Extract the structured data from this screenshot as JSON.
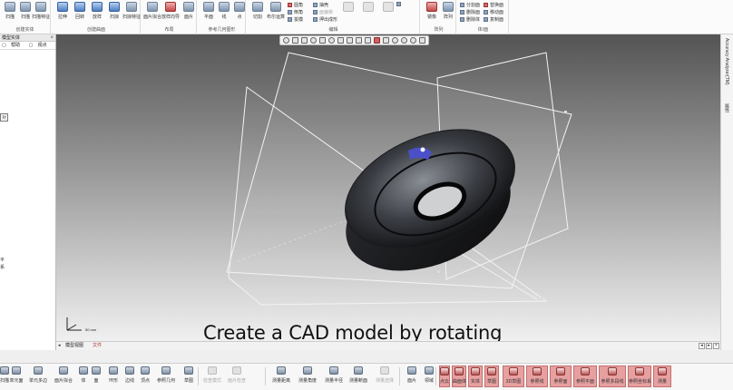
{
  "ribbon": {
    "groups": [
      {
        "label": "创建实体",
        "buttons": [
          "扫描",
          "扫描",
          "扫描特征"
        ]
      },
      {
        "label": "创建曲面",
        "buttons": [
          "拉伸",
          "回转",
          "放样",
          "扫掠",
          "扫掠特征"
        ]
      },
      {
        "label": "布局",
        "buttons": [
          "面片拟合",
          "放样向导",
          "面片"
        ]
      },
      {
        "label": "参考几何图形",
        "buttons": [
          "平面",
          "线",
          "点"
        ]
      },
      {
        "label": "编辑",
        "buttons": [
          "切割",
          "布尔运算"
        ],
        "small": [
          "圆角",
          "倒角",
          "拔模",
          "抽壳",
          "面偏移",
          "押出成形"
        ]
      },
      {
        "label": "阵列",
        "buttons": [
          "镜像",
          "阵列"
        ]
      },
      {
        "label": "体/面",
        "small": [
          "分割面",
          "删除面",
          "删除体",
          "替换面",
          "移动面",
          "复制面"
        ]
      }
    ]
  },
  "left_panel": {
    "title": "模型实体",
    "tabs": [
      "帮助",
      "视点"
    ],
    "tree": [
      "对",
      "平",
      "系"
    ]
  },
  "view_toolbar": {
    "icons": [
      "select-icon",
      "view-icon",
      "fit-icon",
      "zoom-icon",
      "pan-icon",
      "rotate-icon",
      "section-icon",
      "display-icon",
      "render-icon",
      "light-icon",
      "color-icon",
      "texture-icon",
      "measure-icon",
      "probe-icon",
      "ref-icon",
      "hide-icon"
    ]
  },
  "right_rail": {
    "items": [
      "Accuracy Analyzer(TM)",
      "属性"
    ]
  },
  "viewport": {
    "caption": "Create a CAD model by rotating",
    "triad_label": "50 mm"
  },
  "tabstrip": {
    "tabs": [
      "模型视图",
      "文件"
    ],
    "active": 1
  },
  "cmdbar": {
    "buttons": [
      {
        "label": "扫描",
        "state": "normal"
      },
      {
        "label": "单元面",
        "state": "normal"
      },
      {
        "label": "单元多边",
        "state": "normal"
      },
      {
        "label": "面片拟合",
        "state": "normal"
      },
      {
        "label": "体",
        "state": "normal"
      },
      {
        "label": "面",
        "state": "normal"
      },
      {
        "label": "环形",
        "state": "normal"
      },
      {
        "label": "边线",
        "state": "normal"
      },
      {
        "label": "顶点",
        "state": "normal"
      },
      {
        "label": "参照几何",
        "state": "normal"
      },
      {
        "label": "草图",
        "state": "normal"
      },
      {
        "label": "检查模式",
        "state": "dim"
      },
      {
        "label": "面片检查",
        "state": "dim"
      },
      {
        "label": "测量距离",
        "state": "normal"
      },
      {
        "label": "测量角度",
        "state": "normal"
      },
      {
        "label": "测量半径",
        "state": "normal"
      },
      {
        "label": "测量断面",
        "state": "normal"
      },
      {
        "label": "测量选择",
        "state": "dim"
      },
      {
        "label": "面片",
        "state": "normal"
      },
      {
        "label": "领域",
        "state": "normal"
      },
      {
        "label": "点云",
        "state": "hl"
      },
      {
        "label": "曲面体",
        "state": "hl"
      },
      {
        "label": "实体",
        "state": "hl"
      },
      {
        "label": "草图",
        "state": "hl"
      },
      {
        "label": "3D草图",
        "state": "hl"
      },
      {
        "label": "参照线",
        "state": "hl"
      },
      {
        "label": "参照面",
        "state": "hl"
      },
      {
        "label": "参照平面",
        "state": "hl"
      },
      {
        "label": "参照多段线",
        "state": "hl"
      },
      {
        "label": "参照坐标系",
        "state": "hl"
      },
      {
        "label": "测量",
        "state": "hl"
      }
    ]
  }
}
